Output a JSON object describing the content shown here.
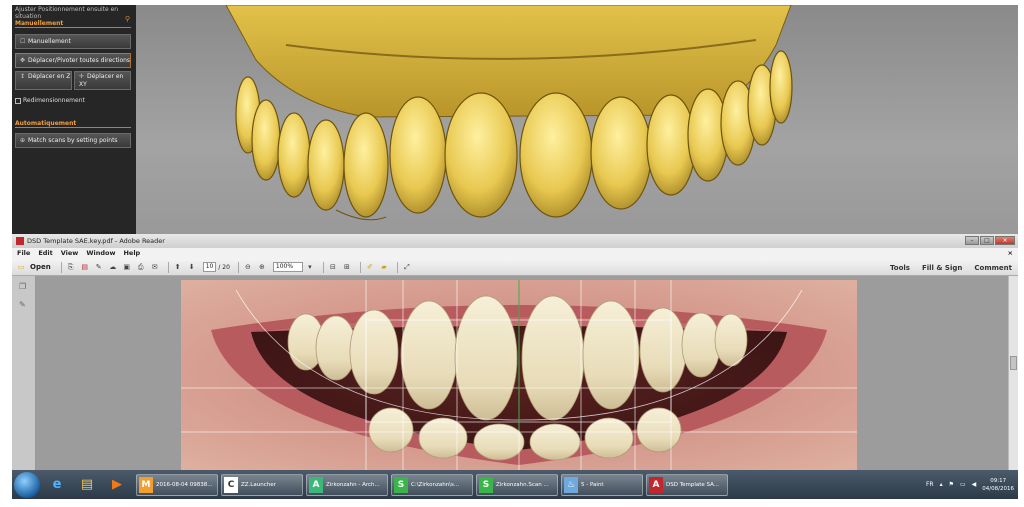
{
  "scan_app": {
    "panel_note": "Ajuster Positionnement ensuite en situation",
    "section_manual": "Manuellement",
    "manual_button": "Manuellement",
    "move_all_button": "Déplacer/Pivoter toutes directions",
    "move_z_button": "Déplacer en Z",
    "move_xy_button": "Déplacer en XY",
    "resize_checkbox": "Redimensionnement",
    "section_auto": "Automatiquement",
    "match_button": "Match scans by setting points"
  },
  "reader": {
    "window_title": "DSD Template SAE.key.pdf - Adobe Reader",
    "menu": [
      "File",
      "Edit",
      "View",
      "Window",
      "Help"
    ],
    "menu_close": "×",
    "open_label": "Open",
    "page_current": "10",
    "page_total": "/ 20",
    "zoom": "100%",
    "tools_label": "Tools",
    "fill_sign_label": "Fill & Sign",
    "comment_label": "Comment",
    "win_minimize": "–",
    "win_maximize": "□",
    "win_close": "×"
  },
  "taskbar": {
    "tasks": [
      {
        "label": "2016-08-04 09838...",
        "color": "#f0a030",
        "glyph": "M"
      },
      {
        "label": "ZZ.Launcher",
        "color": "#ffffff",
        "glyph": "C"
      },
      {
        "label": "Zirkonzahn - Arch...",
        "color": "#3cb878",
        "glyph": "A"
      },
      {
        "label": "C:\\Zirkonzahn\\s...",
        "color": "#39b54a",
        "glyph": "S"
      },
      {
        "label": "Zirkonzahn.Scan ...",
        "color": "#39b54a",
        "glyph": "S"
      },
      {
        "label": "5 - Paint",
        "color": "#6fa8dc",
        "glyph": "♨"
      },
      {
        "label": "DSD Template SA...",
        "color": "#c0282e",
        "glyph": "A"
      }
    ],
    "lang": "FR",
    "time": "09:17",
    "date": "04/08/2016"
  }
}
